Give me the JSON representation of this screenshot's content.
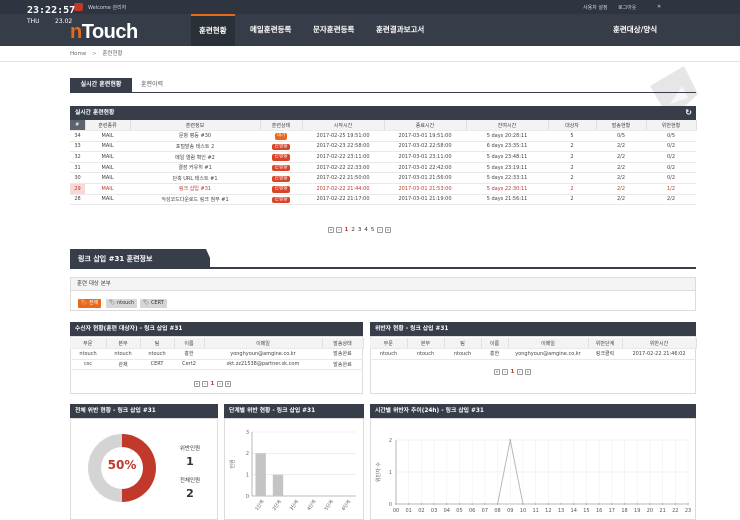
{
  "topbar": {
    "welcome": "Welcome 관리자",
    "user_settings": "사용자 설정",
    "logout": "로그아웃",
    "close": "✕"
  },
  "clock": {
    "time": "23:22:57",
    "day": "THU",
    "date": "23.02"
  },
  "logo": {
    "prefix": "n",
    "name": "Touch"
  },
  "nav": {
    "items": [
      {
        "label": "훈련현황"
      },
      {
        "label": "메일훈련등록"
      },
      {
        "label": "문자훈련등록"
      },
      {
        "label": "훈련결과보고서"
      },
      {
        "label": "훈련대상/양식"
      }
    ],
    "active_index": 0
  },
  "breadcrumb": {
    "home": "Home",
    "sep": ">",
    "current": "훈련현황"
  },
  "tabs": [
    {
      "label": "실시간 훈련현황"
    },
    {
      "label": "훈련이력"
    }
  ],
  "realtime": {
    "title": "실시간 훈련현황",
    "refresh_icon": "↻",
    "columns": [
      "#",
      "훈련종류",
      "훈련정보",
      "훈련상태",
      "시작시간",
      "종료시간",
      "잔여시간",
      "대상자",
      "발송현황",
      "위반현황"
    ],
    "rows": [
      {
        "id": "34",
        "type": "MAIL",
        "info": "문항 평등 #30",
        "status": "대기",
        "start": "2017-02-25 19:51:00",
        "end": "2017-03-01 19:51:00",
        "remain": "5 days 20:28:11",
        "targets": "5",
        "sent": "0/5",
        "violations": "0/5"
      },
      {
        "id": "33",
        "type": "MAIL",
        "info": "포털발송 테스트 2",
        "status": "진행중",
        "start": "2017-02-23 22:58:00",
        "end": "2017-03-02 22:58:00",
        "remain": "6 days 23:35:11",
        "targets": "2",
        "sent": "2/2",
        "violations": "0/2"
      },
      {
        "id": "32",
        "type": "MAIL",
        "info": "메일 열람 확인 #2",
        "status": "진행중",
        "start": "2017-02-22 23:11:00",
        "end": "2017-03-01 23:11:00",
        "remain": "5 days 23:48:11",
        "targets": "2",
        "sent": "2/2",
        "violations": "0/2"
      },
      {
        "id": "31",
        "type": "MAIL",
        "info": "결장 커유히 #1",
        "status": "진행중",
        "start": "2017-02-22 22:33:00",
        "end": "2017-03-01 22:42:00",
        "remain": "5 days 23:19:11",
        "targets": "2",
        "sent": "2/2",
        "violations": "0/2"
      },
      {
        "id": "30",
        "type": "MAIL",
        "info": "단축 URL 테스트 #1",
        "status": "진행중",
        "start": "2017-02-22 21:50:00",
        "end": "2017-03-01 21:56:00",
        "remain": "5 days 22:33:11",
        "targets": "2",
        "sent": "2/2",
        "violations": "0/2"
      },
      {
        "id": "29",
        "type": "MAIL",
        "info": "링크 삽입 #31",
        "status": "진행중",
        "start": "2017-02-22 21:44:00",
        "end": "2017-03-01 21:53:00",
        "remain": "5 days 22:30:11",
        "targets": "2",
        "sent": "2/2",
        "violations": "1/2"
      },
      {
        "id": "28",
        "type": "MAIL",
        "info": "악성코드다운로드 링크 첨부 #1",
        "status": "진행중",
        "start": "2017-02-22 21:17:00",
        "end": "2017-03-01 21:19:00",
        "remain": "5 days 21:56:11",
        "targets": "2",
        "sent": "2/2",
        "violations": "2/2"
      }
    ],
    "selected_row": 5,
    "pager": {
      "first": "«",
      "prev": "‹",
      "pages": [
        "1",
        "2",
        "3",
        "4",
        "5"
      ],
      "current": "1",
      "next": "›",
      "last": "»"
    }
  },
  "section": {
    "title": "링크 삽입 #31 훈련정보"
  },
  "target_group": {
    "title": "훈련 대상 본부",
    "chips": [
      {
        "label": "전체",
        "icon": "tag-icon"
      },
      {
        "label": "ntouch",
        "icon": "tag-icon"
      },
      {
        "label": "CERT",
        "icon": "tag-icon"
      }
    ]
  },
  "recipients": {
    "title": "수신자 현황(훈련 대상자) - 링크 삽입 #31",
    "columns": [
      "부문",
      "본부",
      "팀",
      "이름",
      "이메일",
      "발송상태"
    ],
    "rows": [
      {
        "dept": "ntouch",
        "hq": "ntouch",
        "team": "ntouch",
        "name": "홍한",
        "email": "yonghyoun@amgine.co.kr",
        "status": "발송완료"
      },
      {
        "dept": "csc",
        "hq": "관제",
        "team": "CERT",
        "name": "Cert2",
        "email": "skt.zz21538@partner.sk.com",
        "status": "발송완료"
      }
    ],
    "pager": {
      "first": "«",
      "prev": "‹",
      "pages": [
        "1"
      ],
      "current": "1",
      "next": "›",
      "last": "»"
    }
  },
  "violators": {
    "title": "위반자 현황 - 링크 삽입 #31",
    "columns": [
      "부문",
      "본부",
      "팀",
      "이름",
      "이메일",
      "위반단계",
      "위반시간"
    ],
    "rows": [
      {
        "dept": "ntouch",
        "hq": "ntouch",
        "team": "ntouch",
        "name": "홍한",
        "email": "yonghyoun@amgine.co.kr",
        "stage": "링크클릭",
        "time": "2017-02-22 21:46:02"
      }
    ],
    "pager": {
      "first": "«",
      "prev": "‹",
      "pages": [
        "1"
      ],
      "current": "1",
      "next": "›",
      "last": "»"
    }
  },
  "overall": {
    "title": "전체 위반 현황 - 링크 삽입 #31",
    "percent": "50%",
    "percent_value": 50,
    "violators_label": "위반인원",
    "violators_value": "1",
    "total_label": "전체인원",
    "total_value": "2",
    "colors": {
      "filled": "#c0392b",
      "empty": "#d4d4d4"
    }
  },
  "stage_chart": {
    "title": "단계별 위반 현황 - 링크 삽입 #31"
  },
  "time_chart": {
    "title": "시간별 위반자 추이(24h) - 링크 삽입 #31"
  },
  "chart_data": [
    {
      "type": "bar",
      "categories": [
        "1단계",
        "2단계",
        "3단계",
        "4단계",
        "5단계",
        "6단계"
      ],
      "values": [
        2,
        1,
        0,
        0,
        0,
        0
      ],
      "ylabel": "인원",
      "ylim": [
        0,
        3
      ],
      "yticks": [
        "0",
        "1",
        "2",
        "3"
      ],
      "grid": true
    },
    {
      "type": "line",
      "x": [
        "00",
        "01",
        "02",
        "03",
        "04",
        "05",
        "06",
        "07",
        "08",
        "09",
        "10",
        "11",
        "12",
        "13",
        "14",
        "15",
        "16",
        "17",
        "18",
        "19",
        "20",
        "21",
        "22",
        "23"
      ],
      "values": [
        0,
        0,
        0,
        0,
        0,
        0,
        0,
        0,
        0,
        2,
        0,
        0,
        0,
        0,
        0,
        0,
        0,
        0,
        0,
        0,
        0,
        0,
        0,
        0
      ],
      "ylabel": "위반자 수",
      "ylim": [
        0,
        2
      ],
      "yticks": [
        "0",
        "1",
        "2"
      ],
      "grid": true
    }
  ]
}
